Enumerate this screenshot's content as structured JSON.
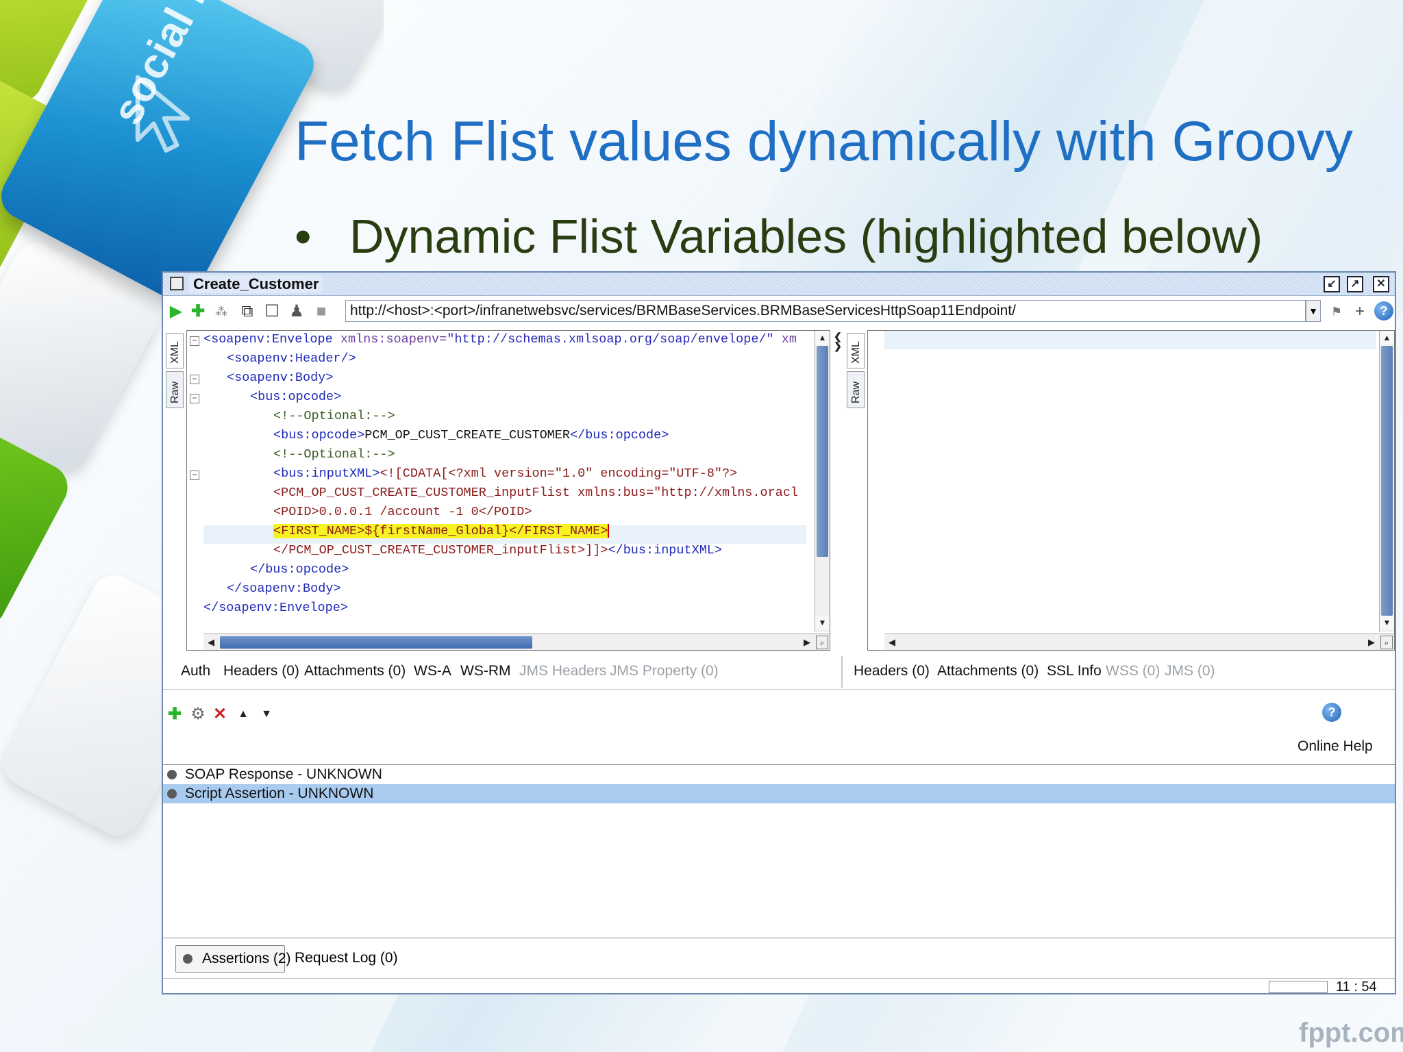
{
  "slide": {
    "title": "Fetch Flist values dynamically with Groovy",
    "bullet": "Dynamic Flist Variables (highlighted below)",
    "decor_key_text": "social networks",
    "watermark": "fppt.com"
  },
  "window": {
    "title": "Create_Customer",
    "endpoint_url": "http://<host>:<port>/infranetwebsvc/services/BRMBaseServices.BRMBaseServicesHttpSoap11Endpoint/"
  },
  "request_editor": {
    "tab_xml": "XML",
    "tab_raw": "Raw",
    "lines": [
      {
        "tag": "<soapenv:Envelope",
        "attr": " xmlns:soapenv=",
        "val": "\"http://schemas.xmlsoap.org/soap/envelope/\"",
        "rest": " xm"
      },
      {
        "text": "<soapenv:Header/>"
      },
      {
        "text": "<soapenv:Body>"
      },
      {
        "text": "<bus:opcode>"
      },
      {
        "text": "<!--Optional:-->"
      },
      {
        "open": "<bus:opcode>",
        "content": "PCM_OP_CUST_CREATE_CUSTOMER",
        "close": "</bus:opcode>"
      },
      {
        "text": "<!--Optional:-->"
      },
      {
        "open": "<bus:inputXML>",
        "content": "<![CDATA[<?xml version=\"1.0\" encoding=\"UTF-8\"?>"
      },
      {
        "text": "<PCM_OP_CUST_CREATE_CUSTOMER_inputFlist xmlns:bus=\"http://xmlns.oracl"
      },
      {
        "text": "<POID>0.0.0.1 /account -1 0</POID>"
      },
      {
        "text": "<FIRST_NAME>${firstName_Global}</FIRST_NAME>"
      },
      {
        "open": "</PCM_OP_CUST_CREATE_CUSTOMER_inputFlist>]]>",
        "close": "</bus:inputXML>"
      },
      {
        "text": "</bus:opcode>"
      },
      {
        "text": "</soapenv:Body>"
      },
      {
        "text": "</soapenv:Envelope>"
      }
    ]
  },
  "response_editor": {
    "tab_xml": "XML",
    "tab_raw": "Raw"
  },
  "request_tabs": [
    {
      "label": "Auth",
      "enabled": true
    },
    {
      "label": "Headers (0)",
      "enabled": true
    },
    {
      "label": "Attachments (0)",
      "enabled": true
    },
    {
      "label": "WS-A",
      "enabled": true
    },
    {
      "label": "WS-RM",
      "enabled": true
    },
    {
      "label": "JMS Headers",
      "enabled": false
    },
    {
      "label": "JMS Property (0)",
      "enabled": false
    }
  ],
  "response_tabs": [
    {
      "label": "Headers (0)",
      "enabled": true
    },
    {
      "label": "Attachments (0)",
      "enabled": true
    },
    {
      "label": "SSL Info",
      "enabled": true
    },
    {
      "label": "WSS (0)",
      "enabled": false
    },
    {
      "label": "JMS (0)",
      "enabled": false
    }
  ],
  "assertions_panel": {
    "online_help": "Online Help",
    "items": [
      {
        "label": "SOAP Response - UNKNOWN",
        "selected": false
      },
      {
        "label": "Script Assertion - UNKNOWN",
        "selected": true
      }
    ]
  },
  "bottom_tabs": [
    {
      "label": "Assertions (2)",
      "active": true
    },
    {
      "label": "Request Log (0)",
      "active": false
    }
  ],
  "status": {
    "cursor_position": "11 : 54"
  },
  "colors": {
    "title_blue": "#1f6fc4",
    "highlight_yellow": "#f7f323",
    "selection_blue": "#a9cbf0"
  }
}
